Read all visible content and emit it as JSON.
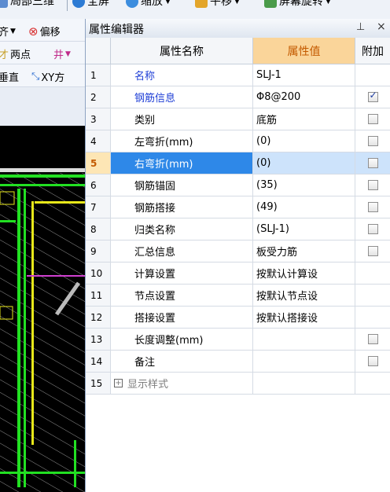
{
  "toolbar": {
    "items": [
      {
        "label": "局部三维",
        "icon": "3d-icon"
      },
      {
        "label": "全屏",
        "icon": "fullscreen-icon"
      },
      {
        "label": "缩放",
        "icon": "zoom-icon"
      },
      {
        "label": "平移",
        "icon": "pan-icon"
      },
      {
        "label": "屏幕旋转",
        "icon": "rotate-icon"
      }
    ],
    "left_rows": [
      [
        {
          "label": "齐",
          "dropdown": true
        },
        {
          "label": "偏移",
          "icon": "offset-icon"
        }
      ],
      [
        {
          "label": "两点",
          "prefix": "才"
        },
        {
          "label": "井",
          "icon": "grid-icon"
        }
      ],
      [
        {
          "label": "垂直",
          "prefix": ""
        },
        {
          "label": "XY方",
          "icon": "xy-icon"
        }
      ]
    ]
  },
  "property_editor": {
    "title": "属性编辑器",
    "pin_glyph": "⊥",
    "close_glyph": "×",
    "columns": [
      "属性名称",
      "属性值",
      "附加"
    ],
    "rows": [
      {
        "num": "1",
        "name": "名称",
        "value": "SLJ-1",
        "blue": true,
        "checkbox": "none"
      },
      {
        "num": "2",
        "name": "钢筋信息",
        "value": "Φ8@200",
        "blue": true,
        "checkbox": "checked"
      },
      {
        "num": "3",
        "name": "类别",
        "value": "底筋",
        "checkbox": "unchecked"
      },
      {
        "num": "4",
        "name": "左弯折(mm)",
        "value": "(0)",
        "checkbox": "unchecked"
      },
      {
        "num": "5",
        "name": "右弯折(mm)",
        "value": "(0)",
        "checkbox": "unchecked",
        "selected": true
      },
      {
        "num": "6",
        "name": "钢筋锚固",
        "value": "(35)",
        "checkbox": "unchecked"
      },
      {
        "num": "7",
        "name": "钢筋搭接",
        "value": "(49)",
        "checkbox": "unchecked"
      },
      {
        "num": "8",
        "name": "归类名称",
        "value": "(SLJ-1)",
        "checkbox": "unchecked"
      },
      {
        "num": "9",
        "name": "汇总信息",
        "value": "板受力筋",
        "checkbox": "unchecked"
      },
      {
        "num": "10",
        "name": "计算设置",
        "value": "按默认计算设",
        "checkbox": "none"
      },
      {
        "num": "11",
        "name": "节点设置",
        "value": "按默认节点设",
        "checkbox": "none"
      },
      {
        "num": "12",
        "name": "搭接设置",
        "value": "按默认搭接设",
        "checkbox": "none"
      },
      {
        "num": "13",
        "name": "长度调整(mm)",
        "value": "",
        "checkbox": "unchecked"
      },
      {
        "num": "14",
        "name": "备注",
        "value": "",
        "checkbox": "unchecked"
      },
      {
        "num": "15",
        "name": "显示样式",
        "value": "",
        "checkbox": "none",
        "expander": "+",
        "gray": true
      }
    ]
  },
  "colors": {
    "header_value_bg": "#fad59a",
    "selected_name_bg": "#2e88e8",
    "cad_background": "#000000",
    "cad_green": "#22e022",
    "cad_yellow": "#e8e81a"
  }
}
